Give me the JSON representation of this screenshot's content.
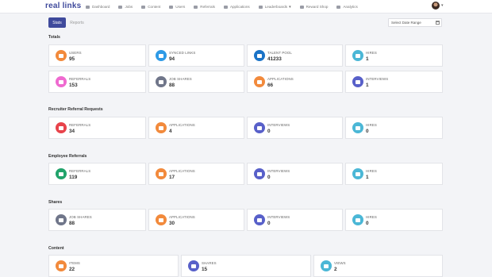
{
  "logo": "real links",
  "nav": [
    "Dashboard",
    "Jobs",
    "Content",
    "Users",
    "Referrals",
    "Applications",
    "Leaderboards",
    "Reward Shop",
    "Analytics"
  ],
  "tabs": {
    "stats": "Stats",
    "reports": "Reports"
  },
  "date_range": {
    "placeholder": "Select Date Range"
  },
  "sections": {
    "totals": {
      "title": "Totals",
      "cards": [
        {
          "label": "Users",
          "value": "95"
        },
        {
          "label": "Synced Links",
          "value": "94"
        },
        {
          "label": "Talent Pool",
          "value": "41233"
        },
        {
          "label": "Hires",
          "value": "1"
        },
        {
          "label": "Referrals",
          "value": "153"
        },
        {
          "label": "Job Shares",
          "value": "88"
        },
        {
          "label": "Applications",
          "value": "66"
        },
        {
          "label": "Interviews",
          "value": "1"
        }
      ]
    },
    "recruiter": {
      "title": "Recruiter Referral Requests",
      "cards": [
        {
          "label": "Referrals",
          "value": "34"
        },
        {
          "label": "Applications",
          "value": "4"
        },
        {
          "label": "Interviews",
          "value": "0"
        },
        {
          "label": "Hires",
          "value": "0"
        }
      ]
    },
    "employee": {
      "title": "Employee Referrals",
      "cards": [
        {
          "label": "Referrals",
          "value": "119"
        },
        {
          "label": "Applications",
          "value": "17"
        },
        {
          "label": "Interviews",
          "value": "0"
        },
        {
          "label": "Hires",
          "value": "1"
        }
      ]
    },
    "shares": {
      "title": "Shares",
      "cards": [
        {
          "label": "Job Shares",
          "value": "88"
        },
        {
          "label": "Applications",
          "value": "30"
        },
        {
          "label": "Interviews",
          "value": "0"
        },
        {
          "label": "Hires",
          "value": "0"
        }
      ]
    },
    "content": {
      "title": "Content",
      "cards": [
        {
          "label": "Items",
          "value": "22"
        },
        {
          "label": "Shares",
          "value": "15"
        },
        {
          "label": "Views",
          "value": "2"
        }
      ]
    }
  },
  "colors": {
    "brand": "#3f4a9c",
    "orange": "#f28a3c",
    "blue": "#2e9ae6",
    "navy": "#1a73c7",
    "teal": "#4bb7d6",
    "pink": "#ef6ad0",
    "gray": "#70768a",
    "indigo": "#5860c9",
    "red": "#e8434b",
    "green": "#21a36b"
  }
}
